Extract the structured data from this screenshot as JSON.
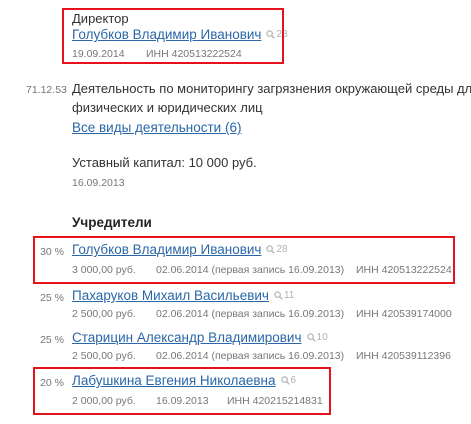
{
  "director": {
    "title": "Директор",
    "name": "Голубков Владимир Иванович",
    "mentions": "28",
    "date": "19.09.2014",
    "inn": "ИНН 420513222524"
  },
  "activity": {
    "code": "71.12.53",
    "description_line1": "Деятельность по мониторингу загрязнения окружающей среды для",
    "description_line2": "физических и юридических лиц",
    "all_link": "Все виды деятельности (6)"
  },
  "capital": {
    "text": "Уставный капитал: 10 000 руб.",
    "date": "16.09.2013"
  },
  "founders": {
    "heading": "Учредители",
    "items": [
      {
        "percent": "30 %",
        "name": "Голубков Владимир Иванович",
        "mentions": "28",
        "amount": "3 000,00 руб.",
        "date": "02.06.2014 (первая запись 16.09.2013)",
        "inn": "ИНН 420513222524"
      },
      {
        "percent": "25 %",
        "name": "Пахаруков Михаил Васильевич",
        "mentions": "11",
        "amount": "2 500,00 руб.",
        "date": "02.06.2014 (первая запись 16.09.2013)",
        "inn": "ИНН 420539174000"
      },
      {
        "percent": "25 %",
        "name": "Старицин Александр Владимирович",
        "mentions": "10",
        "amount": "2 500,00 руб.",
        "date": "02.06.2014 (первая запись 16.09.2013)",
        "inn": "ИНН 420539112396"
      },
      {
        "percent": "20 %",
        "name": "Лабушкина Евгения Николаевна",
        "mentions": "6",
        "amount": "2 000,00 руб.",
        "date": "16.09.2013",
        "inn": "ИНН 420215214831"
      }
    ]
  },
  "colors": {
    "link": "#2a67a8",
    "highlight": "#e3131b",
    "muted": "#777777"
  },
  "icons": {
    "mentions": "search-icon"
  }
}
